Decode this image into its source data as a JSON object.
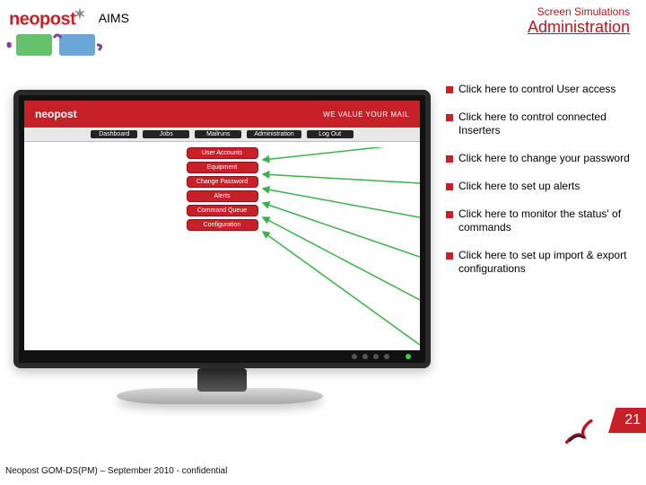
{
  "brand": {
    "name": "neopost",
    "sup": "✶"
  },
  "header": {
    "aims": "AIMS",
    "ss": "Screen Simulations",
    "adm": "Administration"
  },
  "app": {
    "logo": "neopost",
    "tagline": "WE VALUE YOUR MAIL"
  },
  "nav": [
    "Dashboard",
    "Jobs",
    "Mailruns",
    "Administration",
    "Log Out"
  ],
  "subnav": [
    "User Accounts",
    "Equipment",
    "Change Password",
    "Alerts",
    "Command Queue",
    "Configuration"
  ],
  "callouts": [
    "Click here to control User access",
    "Click here to control connected Inserters",
    "Click here to change your password",
    "Click here to set up alerts",
    "Click here to monitor the status' of commands",
    "Click here to set up import & export configurations"
  ],
  "page": "21",
  "footer": "Neopost GOM-DS(PM) – September 2010 - confidential"
}
